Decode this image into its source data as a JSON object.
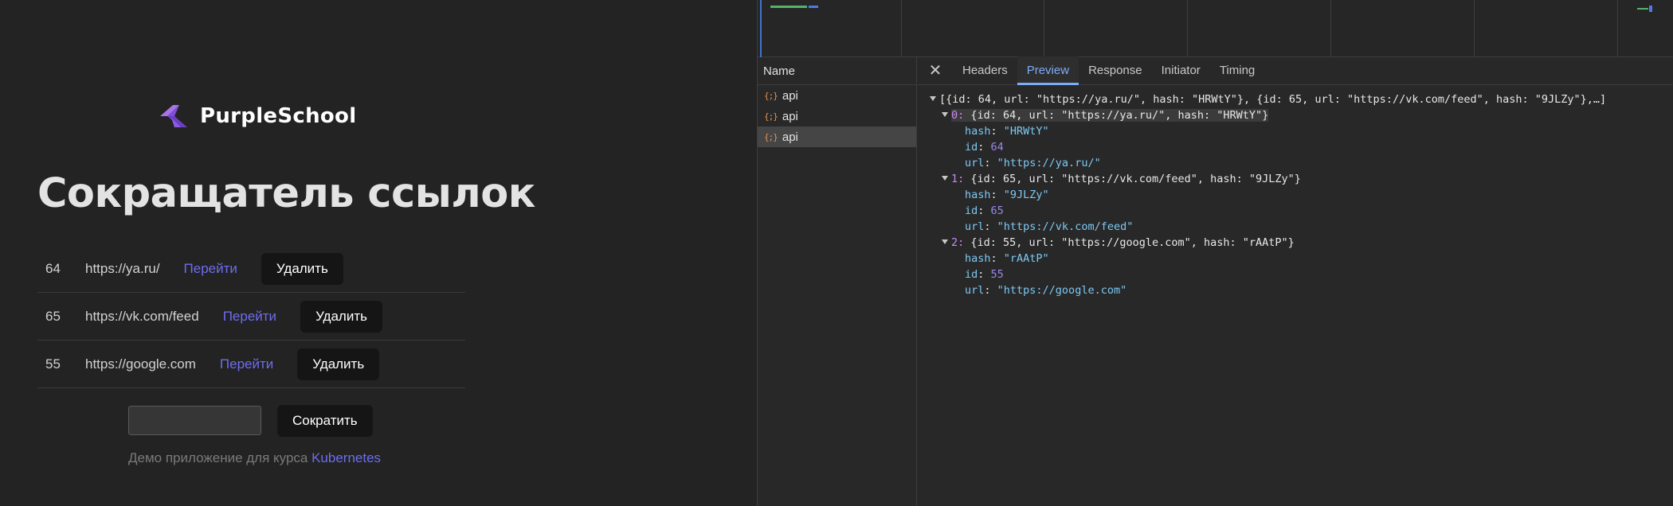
{
  "app": {
    "logo_text": "PurpleSchool",
    "title": "Сокращатель ссылок",
    "links": [
      {
        "id": "64",
        "url": "https://ya.ru/",
        "go_label": "Перейти",
        "delete_label": "Удалить"
      },
      {
        "id": "65",
        "url": "https://vk.com/feed",
        "go_label": "Перейти",
        "delete_label": "Удалить"
      },
      {
        "id": "55",
        "url": "https://google.com",
        "go_label": "Перейти",
        "delete_label": "Удалить"
      }
    ],
    "input_value": "",
    "shorten_label": "Сократить",
    "footer_text": "Демо приложение для курса ",
    "footer_link": "Kubernetes",
    "accent_color": "#6d6df0"
  },
  "devtools": {
    "name_header": "Name",
    "requests": [
      {
        "icon": "{;}",
        "name": "api"
      },
      {
        "icon": "{;}",
        "name": "api"
      },
      {
        "icon": "{;}",
        "name": "api"
      }
    ],
    "selected_request": 2,
    "close_label": "✕",
    "tabs": [
      "Headers",
      "Preview",
      "Response",
      "Initiator",
      "Timing"
    ],
    "active_tab": "Preview",
    "preview": {
      "summary": "[{id: 64, url: \"https://ya.ru/\", hash: \"HRWtY\"}, {id: 65, url: \"https://vk.com/feed\", hash: \"9JLZy\"},…]",
      "items": [
        {
          "index": "0",
          "summary": "{id: 64, url: \"https://ya.ru/\", hash: \"HRWtY\"}",
          "fields": [
            {
              "key": "hash",
              "value": "\"HRWtY\"",
              "type": "string"
            },
            {
              "key": "id",
              "value": "64",
              "type": "number"
            },
            {
              "key": "url",
              "value": "\"https://ya.ru/\"",
              "type": "string"
            }
          ]
        },
        {
          "index": "1",
          "summary": "{id: 65, url: \"https://vk.com/feed\", hash: \"9JLZy\"}",
          "fields": [
            {
              "key": "hash",
              "value": "\"9JLZy\"",
              "type": "string"
            },
            {
              "key": "id",
              "value": "65",
              "type": "number"
            },
            {
              "key": "url",
              "value": "\"https://vk.com/feed\"",
              "type": "string"
            }
          ]
        },
        {
          "index": "2",
          "summary": "{id: 55, url: \"https://google.com\", hash: \"rAAtP\"}",
          "fields": [
            {
              "key": "hash",
              "value": "\"rAAtP\"",
              "type": "string"
            },
            {
              "key": "id",
              "value": "55",
              "type": "number"
            },
            {
              "key": "url",
              "value": "\"https://google.com\"",
              "type": "string"
            }
          ]
        }
      ]
    }
  }
}
